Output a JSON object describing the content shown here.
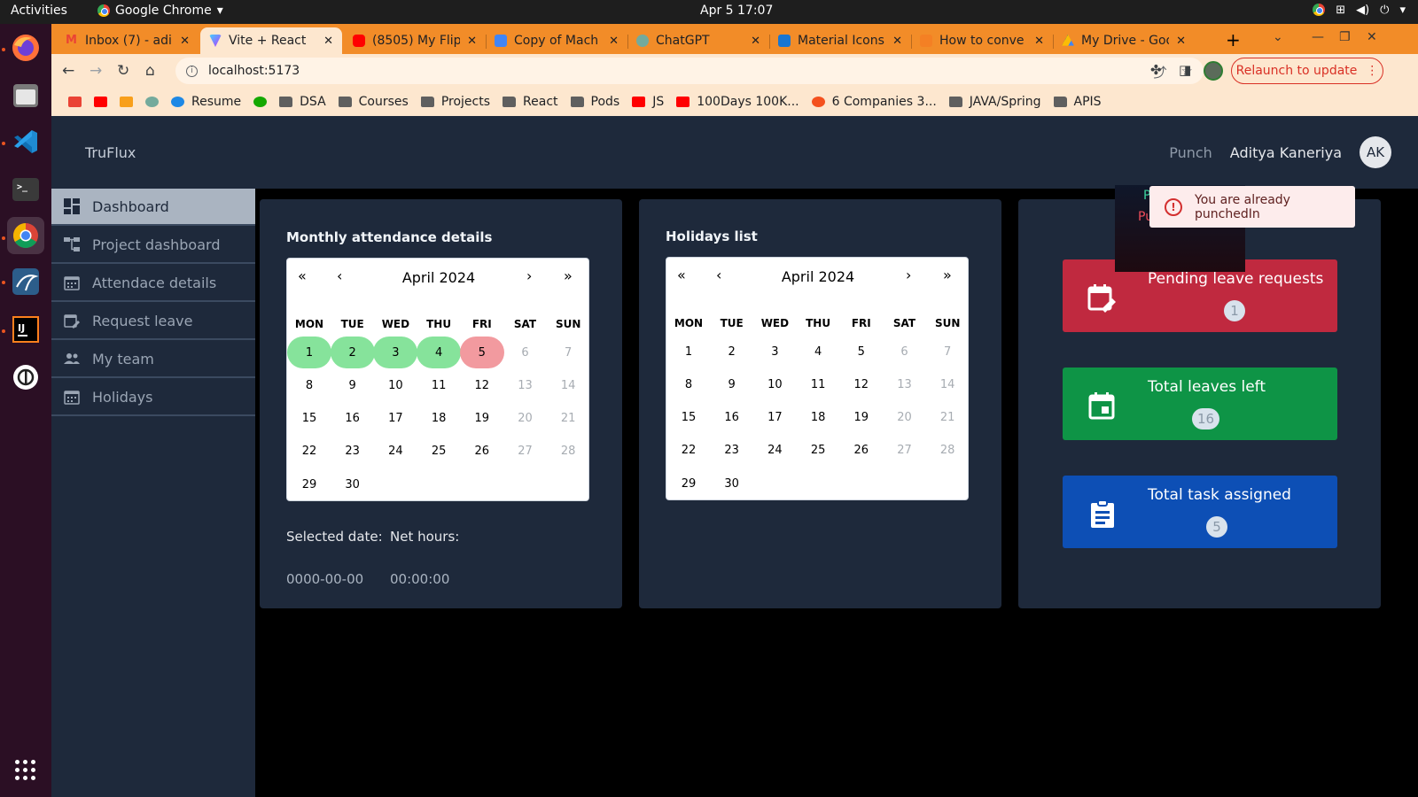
{
  "system": {
    "activities": "Activities",
    "app_name": "Google Chrome",
    "clock": "Apr 5  17:07"
  },
  "tabs": [
    {
      "title": "Inbox (7) - adi",
      "color": "#ea4335"
    },
    {
      "title": "Vite + React",
      "color": "#8a63f4"
    },
    {
      "title": "(8505) My Flip",
      "color": "#ff0000"
    },
    {
      "title": "Copy of Mach",
      "color": "#4285f4"
    },
    {
      "title": "ChatGPT",
      "color": "#74aa9c"
    },
    {
      "title": "Material Icons",
      "color": "#1976d2"
    },
    {
      "title": "How to conve",
      "color": "#f48024"
    },
    {
      "title": "My Drive - Goo",
      "color": "#34a853"
    }
  ],
  "toolbar": {
    "url": "localhost:5173",
    "relaunch_label": "Relaunch to update"
  },
  "bookmarks": [
    {
      "label": "",
      "icon": "gmail-icon",
      "color": "#ea4335"
    },
    {
      "label": "",
      "icon": "youtube-icon",
      "color": "#ff0000"
    },
    {
      "label": "",
      "icon": "leetcode-icon",
      "color": "#f89f1b"
    },
    {
      "label": "",
      "icon": "chatgpt-icon",
      "color": "#74aa9c"
    },
    {
      "label": "Resume",
      "icon": "notion-icon",
      "color": "#1e88e5"
    },
    {
      "label": "",
      "icon": "upwork-icon",
      "color": "#14a800"
    },
    {
      "label": "DSA",
      "icon": "folder-icon",
      "color": "#5f5f5f"
    },
    {
      "label": "Courses",
      "icon": "folder-icon",
      "color": "#5f5f5f"
    },
    {
      "label": "Projects",
      "icon": "folder-icon",
      "color": "#5f5f5f"
    },
    {
      "label": "React",
      "icon": "folder-icon",
      "color": "#5f5f5f"
    },
    {
      "label": "Pods",
      "icon": "folder-icon",
      "color": "#5f5f5f"
    },
    {
      "label": "JS",
      "icon": "youtube-icon",
      "color": "#ff0000"
    },
    {
      "label": "100Days 100K...",
      "icon": "youtube-icon",
      "color": "#ff0000"
    },
    {
      "label": "6 Companies 3...",
      "icon": "dots-icon",
      "color": "#f4511e"
    },
    {
      "label": "JAVA/Spring",
      "icon": "folder-icon",
      "color": "#5f5f5f"
    },
    {
      "label": "APIS",
      "icon": "folder-icon",
      "color": "#5f5f5f"
    }
  ],
  "app": {
    "brand": "TruFlux",
    "punch_label": "Punch",
    "user_name": "Aditya Kaneriya",
    "user_initials": "AK"
  },
  "sidebar": {
    "items": [
      {
        "label": "Dashboard",
        "icon": "dashboard-icon"
      },
      {
        "label": "Project dashboard",
        "icon": "account-tree-icon"
      },
      {
        "label": "Attendace details",
        "icon": "calendar-icon"
      },
      {
        "label": "Request leave",
        "icon": "edit-calendar-icon"
      },
      {
        "label": "My team",
        "icon": "people-icon"
      },
      {
        "label": "Holidays",
        "icon": "calendar-icon"
      }
    ]
  },
  "attendance": {
    "title": "Monthly attendance details",
    "month": "April 2024",
    "nav": [
      "«",
      "‹",
      "›",
      "»"
    ],
    "weekdays": [
      "MON",
      "TUE",
      "WED",
      "THU",
      "FRI",
      "SAT",
      "SUN"
    ],
    "present_days": [
      1,
      2,
      3,
      4
    ],
    "absent_days": [
      5
    ],
    "selected_date_label": "Selected date:",
    "net_hours_label": "Net hours:",
    "selected_date_value": "0000-00-00",
    "net_hours_value": "00:00:00"
  },
  "holidays": {
    "title": "Holidays list",
    "month": "April 2024",
    "nav": [
      "«",
      "‹",
      "›",
      "»"
    ],
    "weekdays": [
      "MON",
      "TUE",
      "WED",
      "THU",
      "FRI",
      "SAT",
      "SUN"
    ]
  },
  "calendar_days": [
    [
      1,
      2,
      3,
      4,
      5,
      6,
      7
    ],
    [
      8,
      9,
      10,
      11,
      12,
      13,
      14
    ],
    [
      15,
      16,
      17,
      18,
      19,
      20,
      21
    ],
    [
      22,
      23,
      24,
      25,
      26,
      27,
      28
    ],
    [
      29,
      30
    ]
  ],
  "stats": [
    {
      "title": "Pending leave requests",
      "value": "1",
      "color": "#c0293f",
      "icon": "edit-calendar-icon"
    },
    {
      "title": "Total leaves left",
      "value": "16",
      "color": "#0e9446",
      "icon": "event-icon"
    },
    {
      "title": "Total task assigned",
      "value": "5",
      "color": "#0d4fb5",
      "icon": "assignment-icon"
    }
  ],
  "toast": {
    "message": "You are already punchedIn",
    "hidden_line1": "P",
    "hidden_line2": "Pu"
  },
  "colors": {
    "present": "#86e39b",
    "absent": "#f29a9f",
    "page_bg": "#1e293b"
  }
}
